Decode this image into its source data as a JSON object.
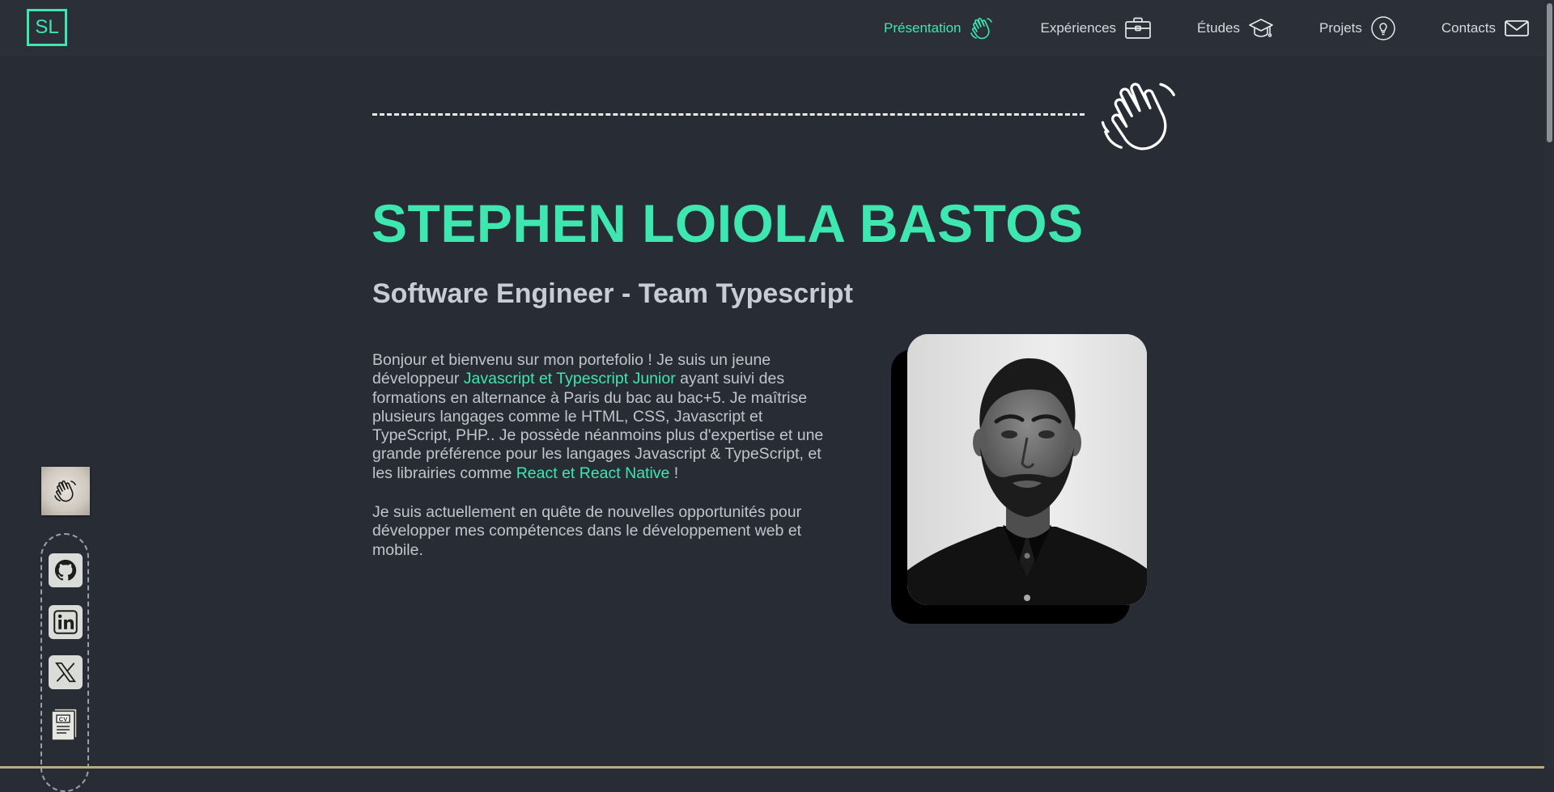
{
  "header": {
    "logo": "SL",
    "nav": [
      {
        "label": "Présentation",
        "icon": "waving-hand-icon",
        "active": true
      },
      {
        "label": "Expériences",
        "icon": "briefcase-icon",
        "active": false
      },
      {
        "label": "Études",
        "icon": "graduation-cap-icon",
        "active": false
      },
      {
        "label": "Projets",
        "icon": "lightbulb-icon",
        "active": false
      },
      {
        "label": "Contacts",
        "icon": "envelope-icon",
        "active": false
      }
    ]
  },
  "hero": {
    "name": "STEPHEN LOIOLA BASTOS",
    "role": "Software Engineer - Team Typescript",
    "bio1_a": "Bonjour et bienvenu sur mon portefolio ! Je suis un jeune développeur ",
    "bio1_hl1": "Javascript et Typescript Junior",
    "bio1_b": " ayant suivi des formations en alternance à Paris du bac au bac+5. Je maîtrise plusieurs langages comme le HTML, CSS, Javascript et TypeScript, PHP.. Je possède néanmoins plus d'expertise et une grande préférence pour les langages Javascript & TypeScript, et les librairies comme ",
    "bio1_hl2": "React et React Native",
    "bio1_c": " !",
    "bio2": "Je suis actuellement en quête de nouvelles opportunités pour développer mes compétences dans le développement web et mobile.",
    "photo_icon": "profile-photo"
  },
  "sidebar": {
    "current_section_icon": "waving-hand-icon",
    "socials": [
      {
        "icon": "github-icon"
      },
      {
        "icon": "linkedin-icon"
      },
      {
        "icon": "x-twitter-icon"
      },
      {
        "icon": "cv-document-icon"
      }
    ]
  },
  "colors": {
    "accent": "#3ee6b0",
    "background": "#282d35",
    "header": "#2b3038"
  }
}
